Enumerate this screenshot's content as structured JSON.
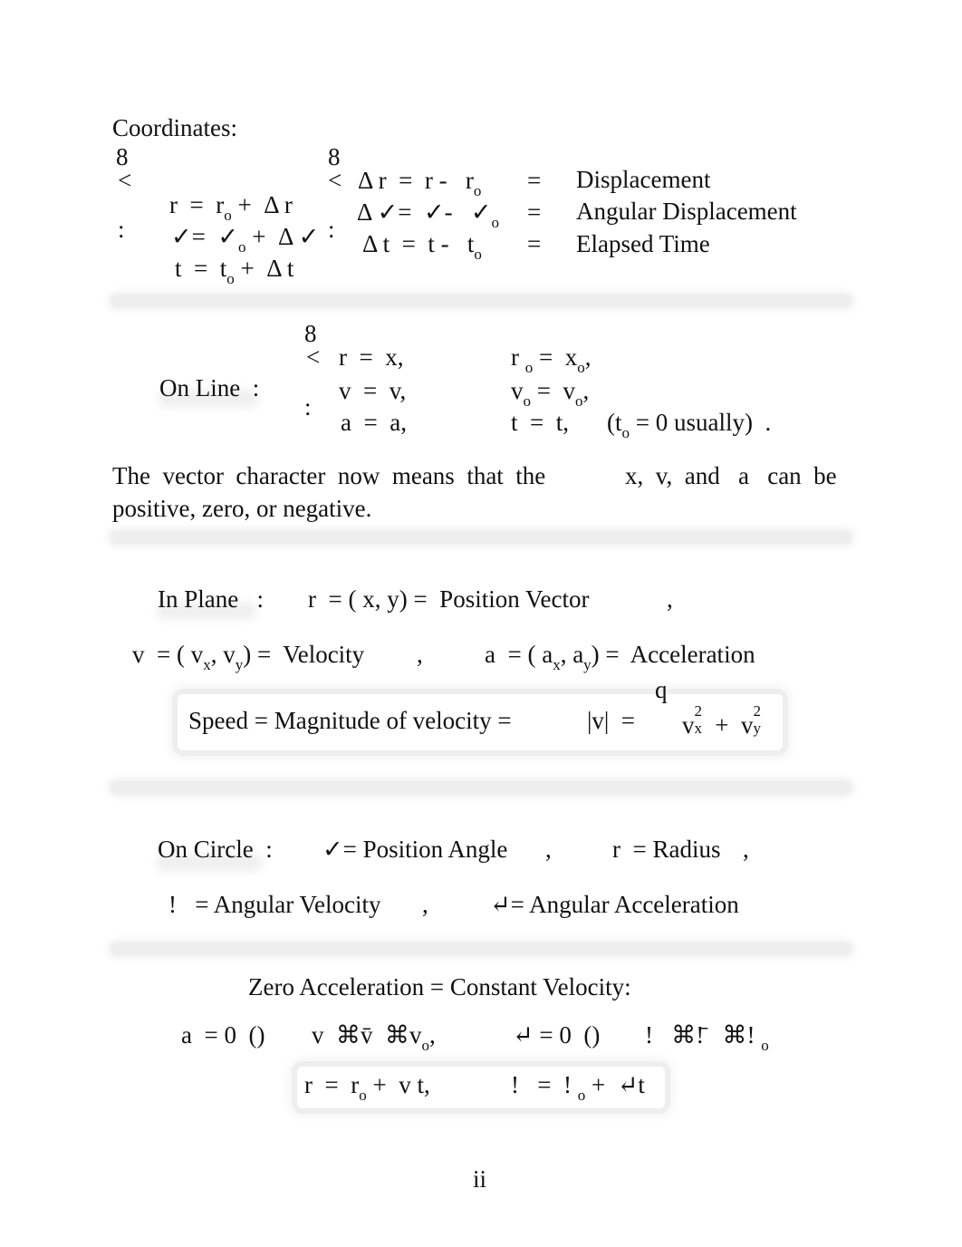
{
  "coordinates": {
    "heading": "Coordinates:",
    "brace_top": "8",
    "brace_mid": "<",
    "brace_bot": ":",
    "left_rows": [
      {
        "lhs": "r",
        "eq": "=",
        "base": "r",
        "sub": "o",
        "rest": "+  Δ r"
      },
      {
        "lhs": "✓",
        "eq": "=",
        "base": "✓",
        "sub": "o",
        "rest": "+  Δ ✓"
      },
      {
        "lhs": "t",
        "eq": "=",
        "base": "t",
        "sub": "o",
        "rest": "+  Δ t"
      }
    ],
    "right_rows": [
      {
        "expr": "Δ r  =  r -   r",
        "sub": "o",
        "eq": "=",
        "meaning": "Displacement"
      },
      {
        "expr": "Δ ✓=  ✓-   ✓",
        "sub": "o",
        "eq": "=",
        "meaning": "Angular Displacement"
      },
      {
        "expr": "Δ t  =  t -   t",
        "sub": "o",
        "eq": "=",
        "meaning": "Elapsed Time"
      }
    ]
  },
  "on_line": {
    "label": "On Line  :",
    "brace_top": "8",
    "brace_mid": "<",
    "brace_bot": ":",
    "col1": [
      "r  =  x,",
      "v  =  v,",
      "a  =  a,"
    ],
    "col2": [
      {
        "a": "r",
        "asub": "o",
        "b": " =  x",
        "bsub": "o",
        "c": ","
      },
      {
        "a": "v",
        "asub": "o",
        "b": " =  v",
        "bsub": "o",
        "c": ","
      },
      {
        "a": "t  =  t,",
        "note_pre": "(t",
        "note_sub": "o",
        "note_post": " = 0 usually)  ."
      }
    ]
  },
  "vector_note": {
    "line1_a": "The  vector  character  now  means  that  the",
    "line1_b": "x,  v,  and   a   can  be",
    "line2": "positive, zero, or negative."
  },
  "in_plane": {
    "label": "In Plane   :",
    "position": "r  = ( x, y) =  Position Vector",
    "position_comma": ",",
    "velocity_pre": "v  = ( v",
    "velocity_sub1": "x",
    "velocity_mid": ", v",
    "velocity_sub2": "y",
    "velocity_post": ") =  Velocity",
    "velocity_comma": ",",
    "accel_pre": "a  = ( a",
    "accel_sub1": "x",
    "accel_mid": ", a",
    "accel_sub2": "y",
    "accel_post": ") =  Acceleration",
    "speed_text": "Speed = Magnitude of velocity =",
    "speed_abs": "|v|  =",
    "sqrt_glyph": "q",
    "sq_v": "v",
    "sq_sub1": "x",
    "sq_sup": "2",
    "sq_plus": " +  v",
    "sq_sub2": "y"
  },
  "on_circle": {
    "label": "On Circle  :",
    "angle": "✓= Position Angle",
    "angle_comma": ",",
    "radius": "r  = Radius",
    "radius_comma": ",",
    "omega": "!   = Angular Velocity",
    "omega_comma": ",",
    "alpha": "↵= Angular Acceleration"
  },
  "zero_accel": {
    "heading": "Zero Acceleration = Constant Velocity:",
    "line_a": "a  = 0  ()",
    "line_b": "v  ⌘v̄  ⌘v",
    "line_b_sub": "o",
    "line_b_end": ",",
    "line_c": "↵ = 0  ()",
    "line_d": "!   ⌘!̄   ⌘!",
    "line_d_sub": "o",
    "box_r": "r  =  r",
    "box_r_sub": "o",
    "box_r_end": " +  v t,",
    "box_w": "!   =  !",
    "box_w_sub": "o",
    "box_w_end": " +  ↵t"
  },
  "page_number": "ii"
}
